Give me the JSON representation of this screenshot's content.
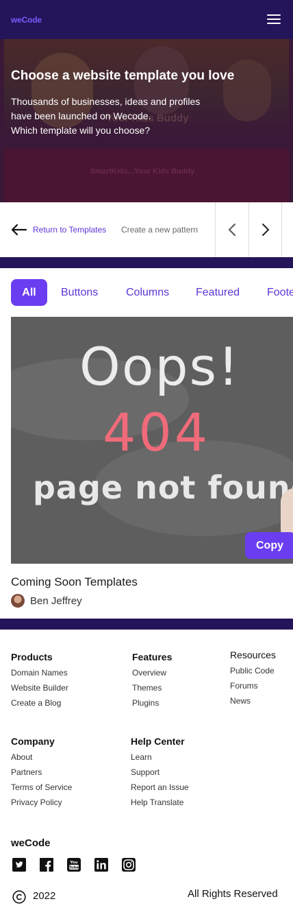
{
  "header": {
    "logo": "weCode",
    "menu_icon": "hamburger-menu-icon"
  },
  "hero": {
    "title": "Choose a website template you love",
    "subtitle_lines": [
      "Thousands of businesses, ideas and profiles",
      "have been launched on Wecode.",
      "Which template will you choose?"
    ],
    "background_text_1": "Your Kids Buddy",
    "background_text_2": "SmartKids...Your Kids Buddy"
  },
  "nav": {
    "back_icon": "arrow-left-icon",
    "return_label": "Return to Templates",
    "create_label": "Create a new pattern",
    "prev_icon": "chevron-left-icon",
    "next_icon": "chevron-right-icon"
  },
  "tabs": [
    "All",
    "Buttons",
    "Columns",
    "Featured",
    "Footer"
  ],
  "active_tab": "All",
  "card": {
    "image_text_1": "Oops!",
    "image_text_2": "404",
    "image_text_3": "page not found.",
    "copy_label": "Copy",
    "title": "Coming Soon Templates",
    "author": "Ben Jeffrey"
  },
  "footer": {
    "products": {
      "title": "Products",
      "links": [
        "Domain Names",
        "Website Builder",
        "Create a Blog"
      ]
    },
    "features": {
      "title": "Features",
      "links": [
        "Overview",
        "Themes",
        "Plugins"
      ]
    },
    "resources": {
      "title": "Resources",
      "links": [
        "Public Code",
        "Forums",
        "News"
      ]
    },
    "company": {
      "title": "Company",
      "links": [
        "About",
        "Partners",
        "Terms of Service",
        "Privacy Policy"
      ]
    },
    "help": {
      "title": "Help Center",
      "links": [
        "Learn",
        "Support",
        "Report an Issue",
        "Help Translate"
      ]
    },
    "brand": "weCode",
    "social_icons": [
      "twitter-icon",
      "facebook-icon",
      "youtube-icon",
      "linkedin-icon",
      "instagram-icon"
    ],
    "year": "2022",
    "rights": "All Rights Reserved"
  },
  "colors": {
    "header_bg": "#24145a",
    "accent": "#6a3df0",
    "link": "#5b35d5",
    "logo": "#7b5cff"
  }
}
